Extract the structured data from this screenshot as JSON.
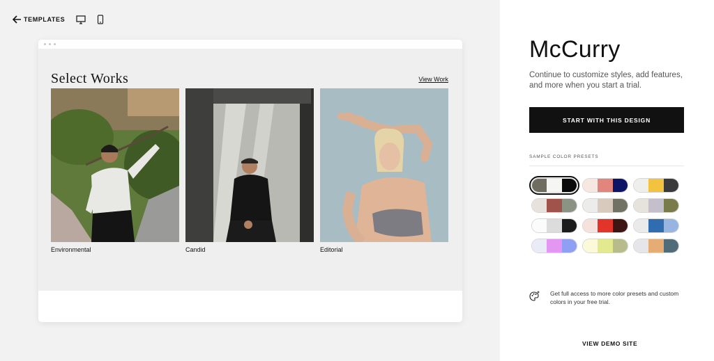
{
  "topbar": {
    "back_label": "TEMPLATES"
  },
  "preview": {
    "site_title": "Select Works",
    "view_work": "View Work",
    "items": [
      {
        "caption": "Environmental"
      },
      {
        "caption": "Candid"
      },
      {
        "caption": "Editorial"
      }
    ]
  },
  "panel": {
    "title": "McCurry",
    "subtitle": "Continue to customize styles, add features, and more when you start a trial.",
    "start_button": "START WITH THIS DESIGN",
    "presets_label": "SAMPLE COLOR PRESETS",
    "presets": [
      {
        "colors": [
          "#6f6d60",
          "#f5f5f2",
          "#0b0b0b"
        ],
        "selected": true
      },
      {
        "colors": [
          "#f6e7e0",
          "#e2857d",
          "#0d1466"
        ],
        "selected": false
      },
      {
        "colors": [
          "#eeeeea",
          "#f3c23f",
          "#3a3a3a"
        ],
        "selected": false
      },
      {
        "colors": [
          "#e8e2dc",
          "#a0534a",
          "#8b9384"
        ],
        "selected": false
      },
      {
        "colors": [
          "#ececea",
          "#d8cbbd",
          "#717263"
        ],
        "selected": false
      },
      {
        "colors": [
          "#e6e2dc",
          "#c3c0cc",
          "#7a7b4a"
        ],
        "selected": false
      },
      {
        "colors": [
          "#fbfbfb",
          "#dcdcdc",
          "#1c1c1c"
        ],
        "selected": false
      },
      {
        "colors": [
          "#f6e2dd",
          "#e3342a",
          "#3e1512"
        ],
        "selected": false
      },
      {
        "colors": [
          "#eaeaea",
          "#2f6db0",
          "#98b4e0"
        ],
        "selected": false
      },
      {
        "colors": [
          "#e9ecf7",
          "#e497f2",
          "#8f9ff3"
        ],
        "selected": false
      },
      {
        "colors": [
          "#fbf9d7",
          "#e2e98e",
          "#b7bc8a"
        ],
        "selected": false
      },
      {
        "colors": [
          "#e6e6ea",
          "#e5ac73",
          "#506c78"
        ],
        "selected": false
      }
    ],
    "info_text": "Get full access to more color presets and custom colors in your free trial.",
    "demo_link": "VIEW DEMO SITE"
  }
}
